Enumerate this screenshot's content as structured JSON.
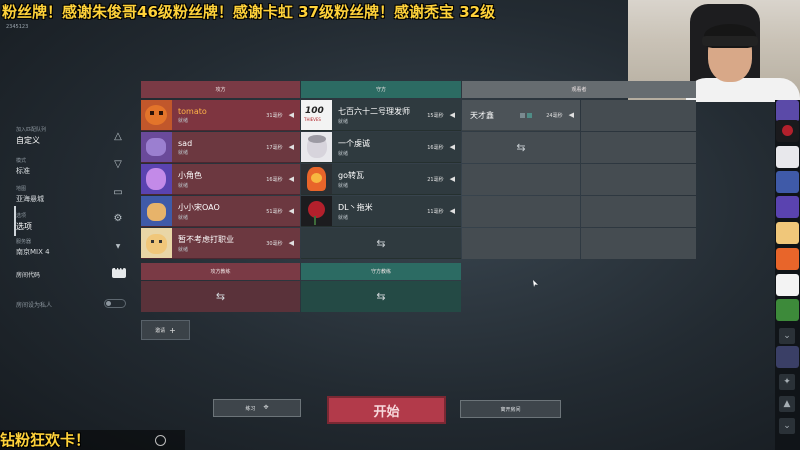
{
  "overlay": {
    "ticker_top": "粉丝牌！感谢朱俊哥46级粉丝牌！感谢卡虹 37级粉丝牌！感谢秃宝 32级",
    "sub_id": "2345123",
    "ticker_bottom": "钻粉狂欢卡！"
  },
  "top_nav": {
    "items": [
      "▲",
      "▲",
      "▼",
      "▼"
    ]
  },
  "left_nav": {
    "section_label": "加入匹配队列",
    "section_value": "自定义",
    "mode_label": "模式",
    "mode_value": "标准",
    "map_label": "地图",
    "map_value": "亚海悬城",
    "options_label": "选项",
    "options_value": "选项",
    "server_label": "服务器",
    "server_value": "南京MIX 4",
    "room_code_label": "房间代码",
    "room_private_label": "房间设为私人"
  },
  "teams": {
    "attackers_header": "攻方",
    "defenders_header": "守方",
    "observers_header": "观看者",
    "attackers_coach_header": "攻方教练",
    "defenders_coach_header": "守方教练",
    "attackers": [
      {
        "name": "tomato",
        "status": "就绪",
        "ping": "31毫秒",
        "highlight": true
      },
      {
        "name": "sad",
        "status": "就绪",
        "ping": "17毫秒",
        "highlight": false
      },
      {
        "name": "小角色",
        "status": "就绪",
        "ping": "16毫秒",
        "highlight": false
      },
      {
        "name": "小小宋OAO",
        "status": "就绪",
        "ping": "51毫秒",
        "highlight": false
      },
      {
        "name": "暂不考虑打职业",
        "status": "就绪",
        "ping": "30毫秒",
        "highlight": false
      }
    ],
    "defenders": [
      {
        "name": "七百六十二号理发师",
        "status": "就绪",
        "ping": "15毫秒"
      },
      {
        "name": "一个虔诚",
        "status": "就绪",
        "ping": "16毫秒"
      },
      {
        "name": "go转瓦",
        "status": "就绪",
        "ping": "21毫秒"
      },
      {
        "name": "DL丶拖米",
        "status": "就绪",
        "ping": "11毫秒"
      }
    ],
    "observers": [
      {
        "name": "天才鑫",
        "ping": "24毫秒"
      }
    ],
    "swap_glyph": "⇆"
  },
  "actions": {
    "invite_label": "邀请",
    "practice_label": "练习",
    "start_label": "开始",
    "leave_label": "离开房间"
  },
  "colors": {
    "attacker": "#7a3a45",
    "defender": "#2c6b63",
    "observer": "#666c70",
    "start_button": "#b23a4a",
    "ticker": "#ffd23a"
  }
}
